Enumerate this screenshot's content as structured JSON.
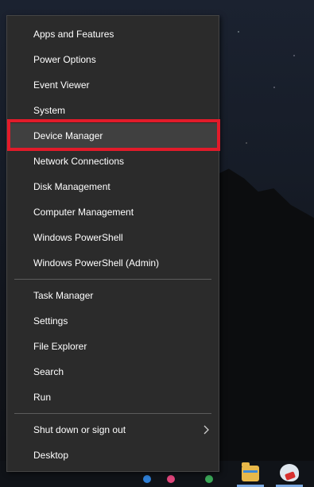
{
  "menu": {
    "groups": [
      {
        "items": [
          {
            "label": "Apps and Features"
          },
          {
            "label": "Power Options"
          },
          {
            "label": "Event Viewer"
          },
          {
            "label": "System"
          },
          {
            "label": "Device Manager"
          },
          {
            "label": "Network Connections"
          },
          {
            "label": "Disk Management"
          },
          {
            "label": "Computer Management"
          },
          {
            "label": "Windows PowerShell"
          },
          {
            "label": "Windows PowerShell (Admin)"
          }
        ]
      },
      {
        "items": [
          {
            "label": "Task Manager"
          },
          {
            "label": "Settings"
          },
          {
            "label": "File Explorer"
          },
          {
            "label": "Search"
          },
          {
            "label": "Run"
          }
        ]
      },
      {
        "items": [
          {
            "label": "Shut down or sign out",
            "submenu_icon": "chevron-right-icon"
          },
          {
            "label": "Desktop"
          }
        ]
      }
    ],
    "highlighted_item": "Device Manager",
    "highlight_outline_color": "#e21b2a",
    "background_color": "#2b2b2b"
  },
  "taskbar": {
    "icons": [
      "file-explorer-icon",
      "paint-icon"
    ]
  }
}
